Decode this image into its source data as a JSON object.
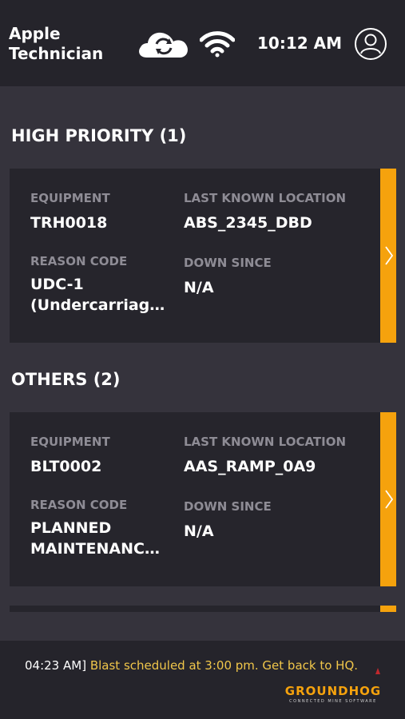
{
  "header": {
    "user_name": "Apple\nTechnician",
    "time": "10:12 AM",
    "icons": [
      "cloud-sync-icon",
      "wifi-icon",
      "user-avatar-icon"
    ]
  },
  "sections": [
    {
      "title": "HIGH PRIORITY (1)",
      "cards": [
        {
          "equipment_label": "EQUIPMENT",
          "equipment": "TRH0018",
          "location_label": "LAST KNOWN LOCATION",
          "location": "ABS_2345_DBD",
          "reason_label": "REASON CODE",
          "reason": "UDC-1\n(Undercarriag…",
          "down_label": "DOWN SINCE",
          "down_since": "N/A"
        }
      ]
    },
    {
      "title": "OTHERS (2)",
      "cards": [
        {
          "equipment_label": "EQUIPMENT",
          "equipment": "BLT0002",
          "location_label": "LAST KNOWN LOCATION",
          "location": "AAS_RAMP_0A9",
          "reason_label": "REASON CODE",
          "reason": "PLANNED\nMAINTENANC…",
          "down_label": "DOWN SINCE",
          "down_since": "N/A"
        }
      ]
    }
  ],
  "footer": {
    "ticker_time": "04:23 AM]",
    "ticker_message": " Blast scheduled at 3:00 pm. Get back to HQ.",
    "logo_text": "GROUNDHOG",
    "logo_tagline": "CONNECTED MINE SOFTWARE"
  },
  "colors": {
    "accent": "#f5a20d",
    "background": "#35333c",
    "card": "#26252c",
    "header": "#25242b",
    "ticker_message": "#f0c64a"
  }
}
